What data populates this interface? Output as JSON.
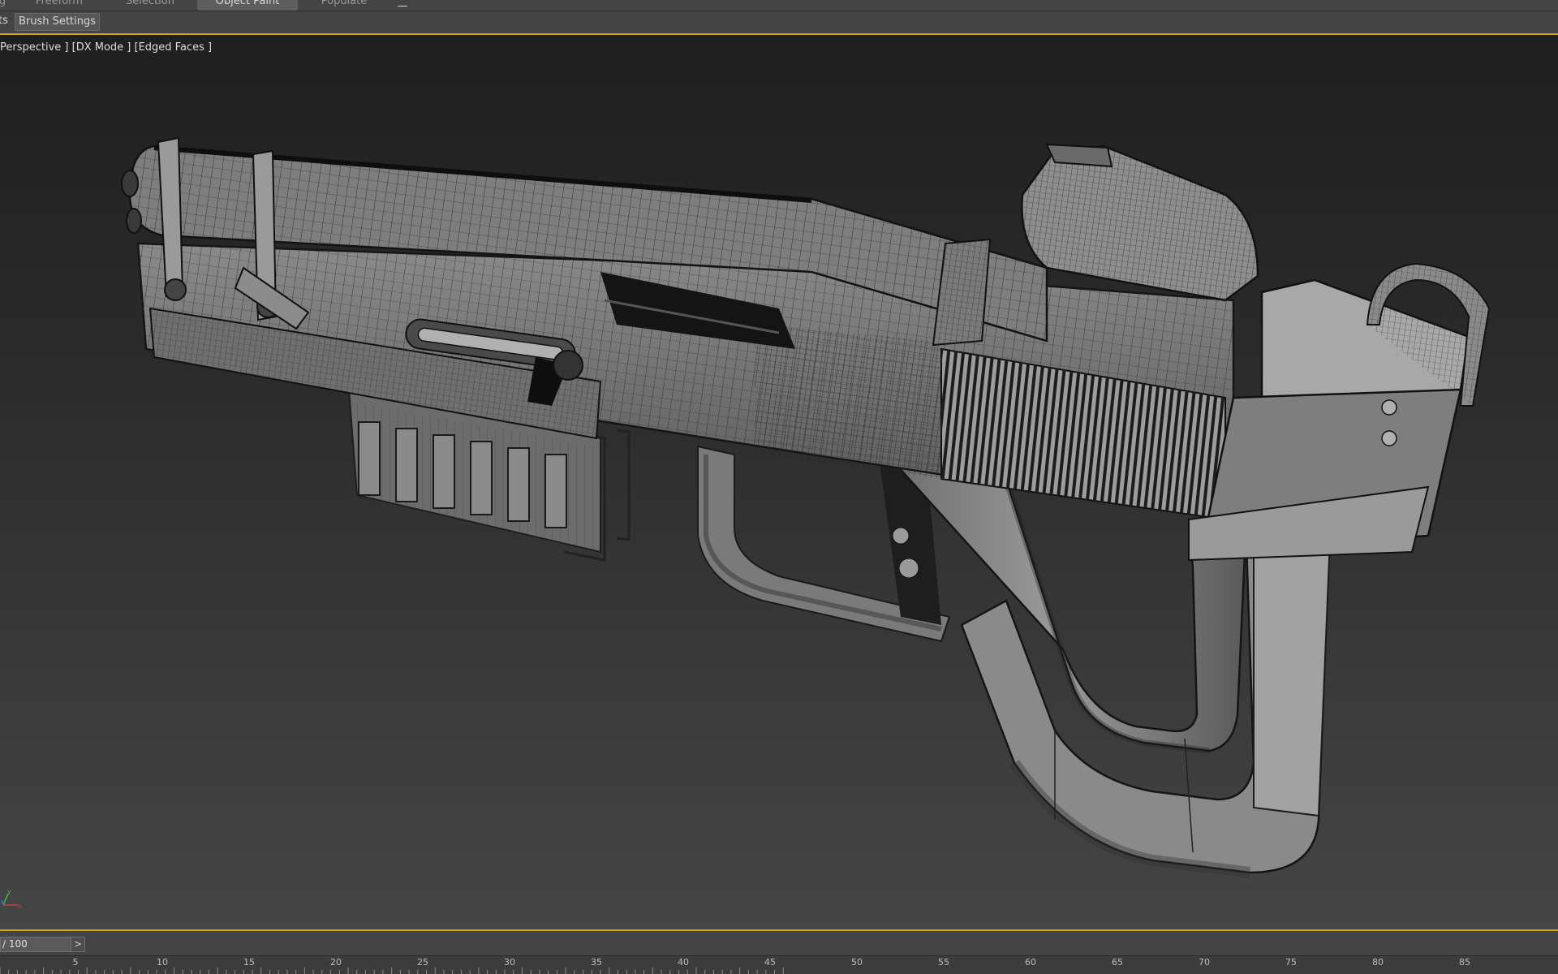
{
  "ribbon": {
    "tabs": [
      {
        "label": "g",
        "active": false
      },
      {
        "label": "Freeform",
        "active": false
      },
      {
        "label": "Selection",
        "active": false
      },
      {
        "label": "Object Paint",
        "active": true
      },
      {
        "label": "Populate",
        "active": false
      }
    ],
    "extra_icon": "ribbon-options-icon",
    "panel_cut_label": "ts",
    "brush_settings_label": "Brush Settings"
  },
  "viewport": {
    "label": "Perspective ] [DX Mode ] [Edged Faces ]",
    "model": "sci-fi pistol mesh (edged faces)",
    "axis_icon": "xyz-axis-tripod-icon"
  },
  "timeline": {
    "slider_text": "/ 100",
    "next_label": ">",
    "tick_labels": [
      "5",
      "10",
      "15",
      "20",
      "25",
      "30",
      "35",
      "40",
      "45",
      "50",
      "55",
      "60",
      "65",
      "70",
      "75",
      "80",
      "85"
    ]
  },
  "colors": {
    "accent": "#c9a227",
    "ui_bg": "#444444"
  }
}
